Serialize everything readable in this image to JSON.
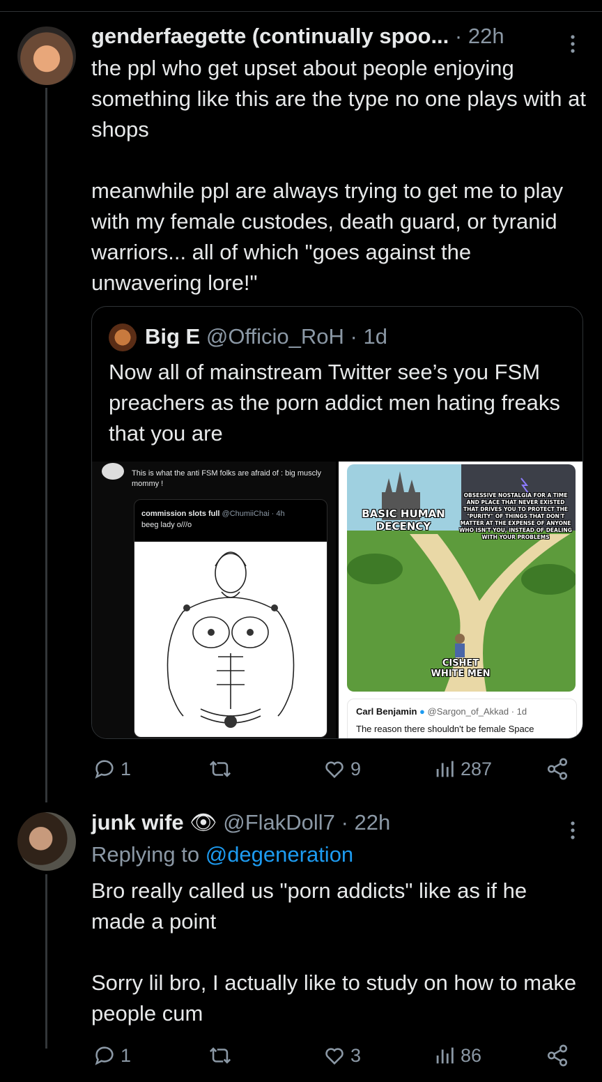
{
  "post1": {
    "display_name": "genderfaegette (continually spoo...",
    "time": "· 22h",
    "more": "⋮",
    "text": "the ppl who get upset about people enjoying something like this are the type no one plays with at shops\n\nmeanwhile ppl are always trying to get me to play with my female custodes, death guard, or tyranid warriors... all of which \"goes against the unwavering lore!\"",
    "quote": {
      "display_name": "Big E",
      "handle": "@Officio_RoH",
      "time": "· 1d",
      "text": "Now all of mainstream Twitter see’s you FSM preachers as the porn addict men hating freaks that you are",
      "image1": {
        "caption": "This is what the anti FSM folks are afraid of : big muscly mommy !",
        "inner_name": "commission slots full",
        "inner_handle": "@ChumiiChai · 4h",
        "inner_text": "beeg lady o///o"
      },
      "image2": {
        "label_left": "BASIC HUMAN DECENCY",
        "label_right": "OBSESSIVE NOSTALGIA FOR A TIME AND PLACE THAT NEVER EXISTED THAT DRIVES YOU TO PROTECT THE \"PURITY\" OF THINGS THAT DON'T MATTER AT THE EXPENSE OF ANYONE WHO ISN'T YOU, INSTEAD OF DEALING WITH YOUR PROBLEMS",
        "label_center": "CISHET WHITE MEN",
        "card_name": "Carl Benjamin",
        "card_handle": "@Sargon_of_Akkad · 1d",
        "card_text": "The reason there shouldn't be female Space"
      }
    },
    "actions": {
      "replies": "1",
      "likes": "9",
      "views": "287"
    }
  },
  "post2": {
    "display_name": "junk wife",
    "handle": "@FlakDoll7",
    "time": "· 22h",
    "more": "⋮",
    "replying_prefix": "Replying to",
    "replying_to": "@degeneration",
    "text": "Bro really called us \"porn addicts\" like as if he made a point\n\nSorry lil bro, I actually like to study on how to make people cum",
    "actions": {
      "replies": "1",
      "likes": "3",
      "views": "86"
    }
  },
  "colors": {
    "accent": "#1d9bf0",
    "muted": "#8b98a5",
    "text": "#e7e9ea",
    "border": "#2f3336"
  }
}
